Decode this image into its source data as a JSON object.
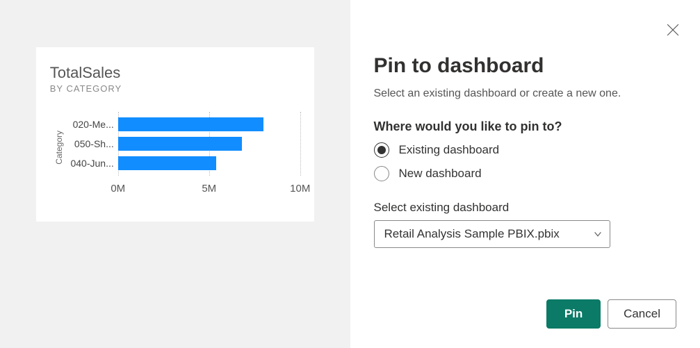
{
  "chart_data": {
    "type": "bar",
    "title": "TotalSales",
    "subtitle": "By Category",
    "ylabel": "Category",
    "xlabel": "",
    "categories": [
      "020-Me...",
      "050-Sh...",
      "040-Jun..."
    ],
    "values": [
      8000000,
      6800000,
      5400000
    ],
    "xlim": [
      0,
      10000000
    ],
    "x_ticks": [
      "0M",
      "5M",
      "10M"
    ]
  },
  "dialog": {
    "title": "Pin to dashboard",
    "description": "Select an existing dashboard or create a new one.",
    "question": "Where would you like to pin to?",
    "option_existing": "Existing dashboard",
    "option_new": "New dashboard",
    "select_label": "Select existing dashboard",
    "select_value": "Retail Analysis Sample PBIX.pbix",
    "pin_label": "Pin",
    "cancel_label": "Cancel"
  }
}
